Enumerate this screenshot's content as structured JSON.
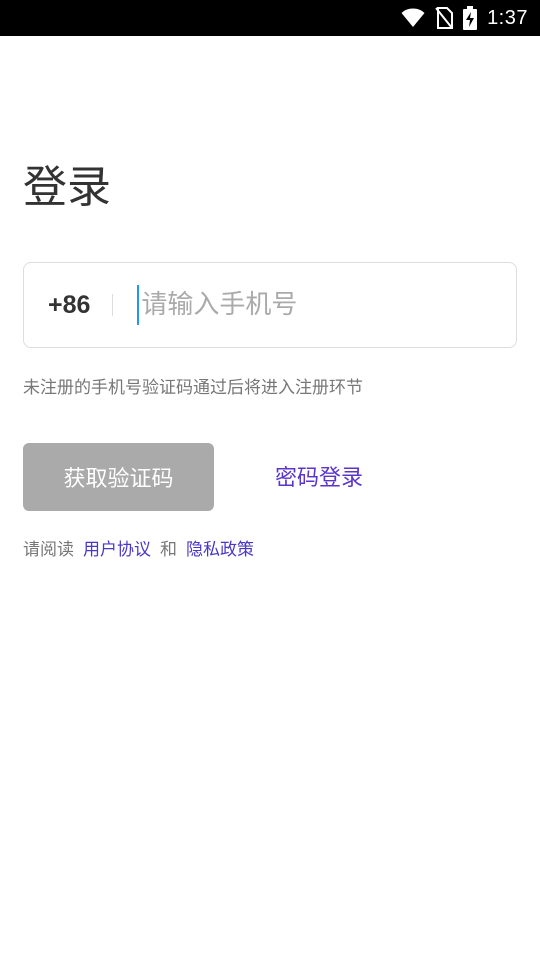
{
  "status_bar": {
    "time": "1:37",
    "icons": [
      "wifi-icon",
      "no-sim-icon",
      "battery-charging-icon"
    ]
  },
  "login": {
    "title": "登录",
    "country_code": "+86",
    "phone_placeholder": "请输入手机号",
    "phone_value": "",
    "hint": "未注册的手机号验证码通过后将进入注册环节",
    "get_code_label": "获取验证码",
    "password_login_label": "密码登录"
  },
  "agreement": {
    "prefix": "请阅读",
    "user_agreement": "用户协议",
    "and": "和",
    "privacy_policy": "隐私政策"
  },
  "colors": {
    "status_bar_bg": "#000000",
    "button_disabled_bg": "#aaaaaa",
    "link": "#5b35c9",
    "cursor": "#2196f3"
  }
}
